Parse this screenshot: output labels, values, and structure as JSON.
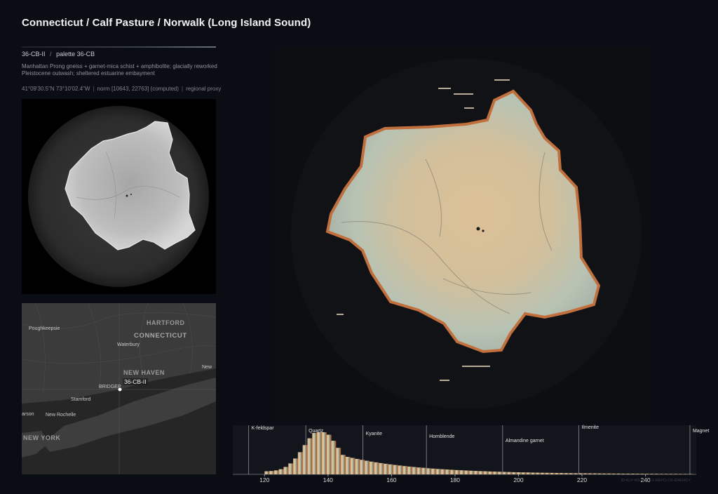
{
  "header": {
    "title": "Connecticut / Calf Pasture / Norwalk (Long Island Sound)"
  },
  "sample": {
    "id": "36-CB-II",
    "separator": "/",
    "palette": "palette 36-CB",
    "description": "Manhattan Prong gneiss + garnet-mica schist + amphibolite; glacially reworked Pleistocene outwash; sheltered estuarine embayment",
    "coords": "41°09'30.5\"N 73°10'02.4\"W",
    "norm": "norm [10643, 22763] (computed)",
    "proxy": "regional proxy"
  },
  "map": {
    "labels": {
      "poughkeepsie": "Poughkeepsie",
      "hartford": "HARTFORD",
      "connecticut": "CONNECTICUT",
      "waterbury": "Waterbury",
      "new_haven": "NEW HAVEN",
      "bridgeport": "BRIDGEP",
      "stamford": "Stamford",
      "new_rochelle": "New Rochelle",
      "new_york": "NEW YORK",
      "larson": "arson",
      "new_right": "New"
    },
    "marker_label": "36-CB-II"
  },
  "histogram": {
    "minerals": [
      {
        "name": "K-feldspar",
        "value": 115
      },
      {
        "name": "Quartz",
        "value": 133
      },
      {
        "name": "Kyanite",
        "value": 151
      },
      {
        "name": "Hornblende",
        "value": 171
      },
      {
        "name": "Almandine garnet",
        "value": 195
      },
      {
        "name": "Ilmenite",
        "value": 219
      },
      {
        "name": "Magnet",
        "value": 254
      }
    ],
    "ticks": [
      120,
      140,
      160,
      180,
      200,
      220,
      240
    ],
    "xlim": [
      110,
      256
    ],
    "footnote": "ID-KLP-RS-WGN-1-REPO-CR-ENERGY"
  },
  "colors": {
    "background": "#0b0d14",
    "grain_core": "#d9bd92",
    "grain_mid": "#b9c4b4",
    "grain_rim": "#c87a4a"
  }
}
